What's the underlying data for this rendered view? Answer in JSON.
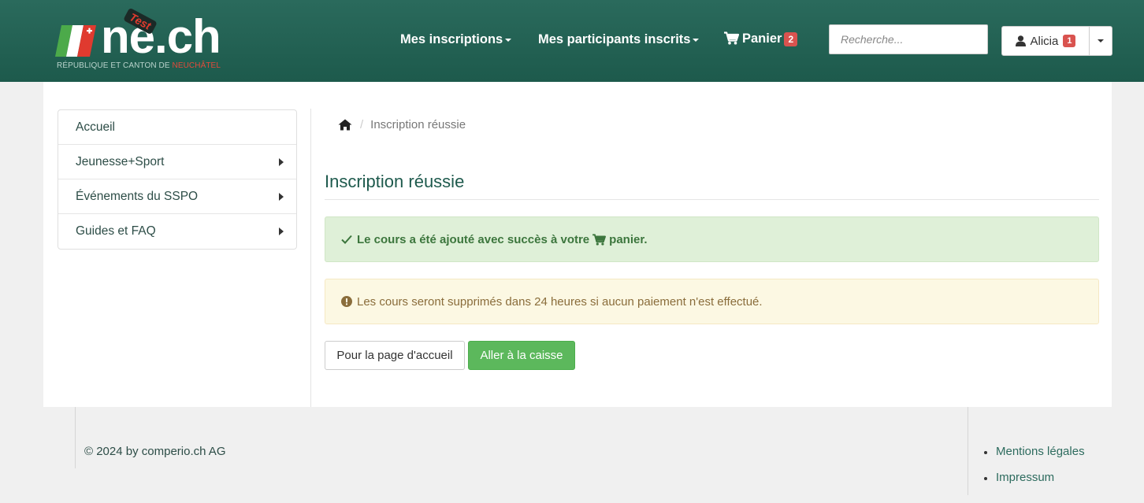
{
  "header": {
    "logo": {
      "brand": "ne.ch",
      "test_label": "Test",
      "tagline_prefix": "RÉPUBLIQUE ET CANTON DE ",
      "tagline_highlight": "NEUCHÂTEL"
    },
    "nav": {
      "inscriptions": "Mes inscriptions",
      "participants": "Mes participants inscrits",
      "cart_label": "Panier",
      "cart_count": "2"
    },
    "search": {
      "placeholder": "Recherche..."
    },
    "user": {
      "name": "Alicia",
      "badge": "1"
    }
  },
  "sidebar": {
    "items": [
      {
        "label": "Accueil",
        "has_arrow": false
      },
      {
        "label": "Jeunesse+Sport",
        "has_arrow": true
      },
      {
        "label": "Événements du SSPO",
        "has_arrow": true
      },
      {
        "label": "Guides et FAQ",
        "has_arrow": true
      }
    ]
  },
  "breadcrumb": {
    "current": "Inscription réussie"
  },
  "main": {
    "title": "Inscription réussie",
    "success_before": "Le cours a été ajouté avec succès à votre",
    "success_after": "panier.",
    "warning": "Les cours seront supprimés dans 24 heures si aucun paiement n'est effectué.",
    "home_button": "Pour la page d'accueil",
    "checkout_button": "Aller à la caisse"
  },
  "footer": {
    "copyright": "© 2024 by comperio.ch AG",
    "links": [
      "Mentions légales",
      "Impressum"
    ]
  },
  "colors": {
    "header": "#1d5a4c",
    "success_bg": "#dff0d8",
    "warning_bg": "#fcf8e3",
    "success_button": "#5cb85c",
    "badge": "#d9534f"
  }
}
